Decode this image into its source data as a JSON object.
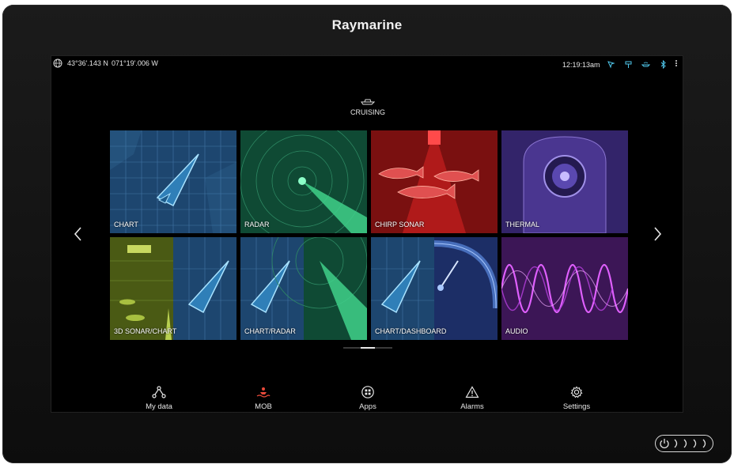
{
  "device": {
    "brand": "Raymarine"
  },
  "statusbar": {
    "latitude": "43°36'.143 N",
    "longitude": "071°19'.006 W",
    "time": "12:19:13am",
    "icons": [
      "gps-icon",
      "ais-icon",
      "boat-sensor-icon",
      "bluetooth-icon",
      "more-menu-icon"
    ]
  },
  "mode": {
    "label": "CRUISING",
    "icon": "boat-icon"
  },
  "apps": [
    {
      "label": "CHART",
      "theme": "#1e4a77"
    },
    {
      "label": "RADAR",
      "theme": "#1a6a4a"
    },
    {
      "label": "CHIRP SONAR",
      "theme": "#8a1414"
    },
    {
      "label": "THERMAL",
      "theme": "#3c2a7a"
    },
    {
      "label": "3D SONAR/CHART",
      "theme": "#5a6a18"
    },
    {
      "label": "CHART/RADAR",
      "theme": "#1d5060"
    },
    {
      "label": "CHART/DASHBOARD",
      "theme": "#203a78"
    },
    {
      "label": "AUDIO",
      "theme": "#4a1a6a"
    }
  ],
  "bottom_bar": {
    "my_data": "My data",
    "mob": "MOB",
    "apps": "Apps",
    "alarms": "Alarms",
    "settings": "Settings"
  },
  "colors": {
    "accent": "#3cc3e0",
    "mob": "#e84a3a"
  }
}
